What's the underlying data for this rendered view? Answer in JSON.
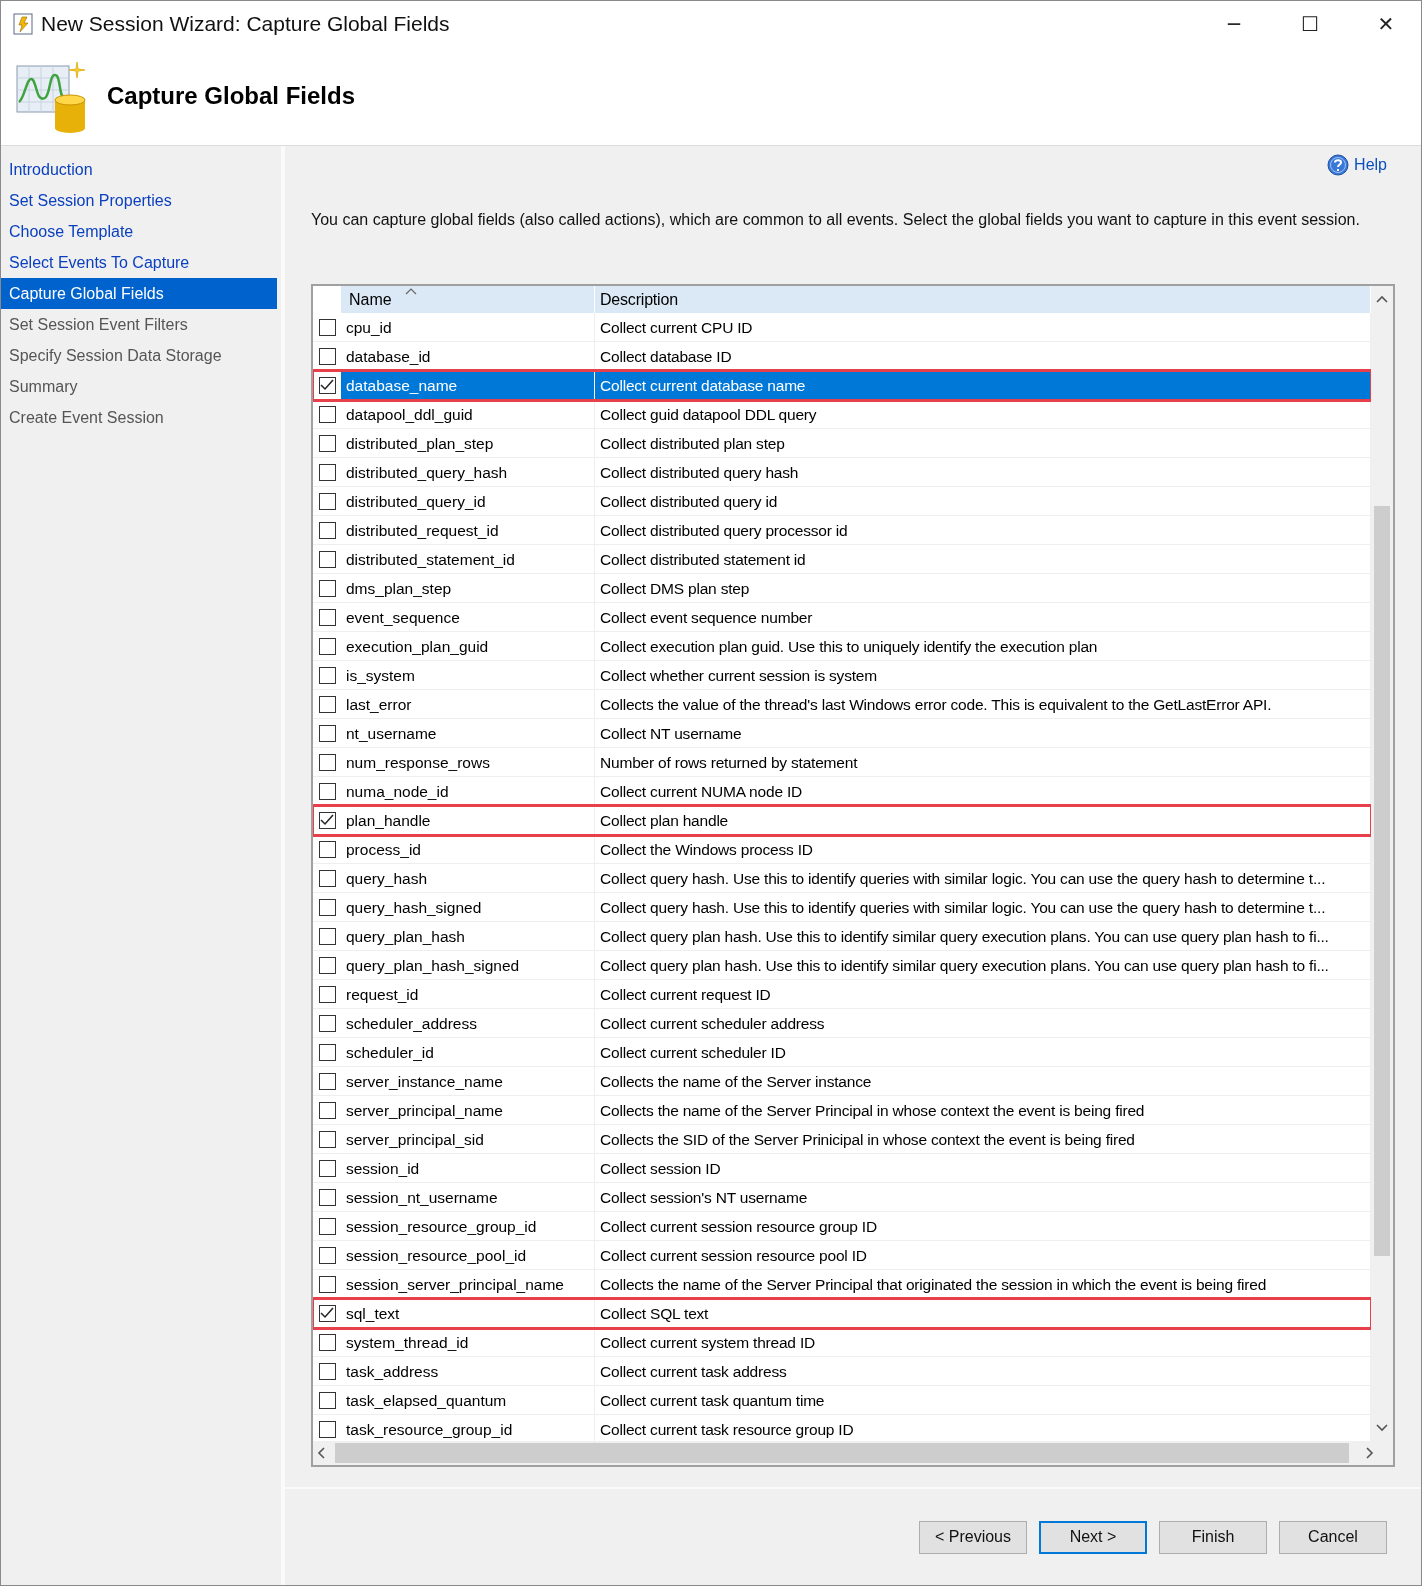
{
  "window": {
    "title": "New Session Wizard: Capture Global Fields",
    "controls": [
      "─",
      "☐",
      "✕"
    ]
  },
  "header": {
    "title": "Capture Global Fields"
  },
  "sidebar": {
    "items": [
      {
        "label": "Introduction",
        "selected": false,
        "disabled": false
      },
      {
        "label": "Set Session Properties",
        "selected": false,
        "disabled": false
      },
      {
        "label": "Choose Template",
        "selected": false,
        "disabled": false
      },
      {
        "label": "Select Events To Capture",
        "selected": false,
        "disabled": false
      },
      {
        "label": "Capture Global Fields",
        "selected": true,
        "disabled": false
      },
      {
        "label": "Set Session Event Filters",
        "selected": false,
        "disabled": true
      },
      {
        "label": "Specify Session Data Storage",
        "selected": false,
        "disabled": true
      },
      {
        "label": "Summary",
        "selected": false,
        "disabled": true
      },
      {
        "label": "Create Event Session",
        "selected": false,
        "disabled": true
      }
    ]
  },
  "help": {
    "label": "Help"
  },
  "intro": "You can capture global fields (also called actions), which are common to all events. Select the global fields you want to capture in this event session.",
  "table": {
    "columns": [
      {
        "label": "Name",
        "sorted": true
      },
      {
        "label": "Description"
      }
    ],
    "rows": [
      {
        "name": "cpu_id",
        "description": "Collect current CPU ID",
        "checked": false,
        "selected": false,
        "highlighted": false
      },
      {
        "name": "database_id",
        "description": "Collect database ID",
        "checked": false,
        "selected": false,
        "highlighted": false
      },
      {
        "name": "database_name",
        "description": "Collect current database name",
        "checked": true,
        "selected": true,
        "highlighted": true
      },
      {
        "name": "datapool_ddl_guid",
        "description": "Collect guid datapool DDL query",
        "checked": false,
        "selected": false,
        "highlighted": false
      },
      {
        "name": "distributed_plan_step",
        "description": "Collect distributed plan step",
        "checked": false,
        "selected": false,
        "highlighted": false
      },
      {
        "name": "distributed_query_hash",
        "description": "Collect distributed query hash",
        "checked": false,
        "selected": false,
        "highlighted": false
      },
      {
        "name": "distributed_query_id",
        "description": "Collect distributed query id",
        "checked": false,
        "selected": false,
        "highlighted": false
      },
      {
        "name": "distributed_request_id",
        "description": "Collect distributed query processor id",
        "checked": false,
        "selected": false,
        "highlighted": false
      },
      {
        "name": "distributed_statement_id",
        "description": "Collect distributed statement id",
        "checked": false,
        "selected": false,
        "highlighted": false
      },
      {
        "name": "dms_plan_step",
        "description": "Collect DMS plan step",
        "checked": false,
        "selected": false,
        "highlighted": false
      },
      {
        "name": "event_sequence",
        "description": "Collect event sequence number",
        "checked": false,
        "selected": false,
        "highlighted": false
      },
      {
        "name": "execution_plan_guid",
        "description": "Collect execution plan guid. Use this to uniquely identify the execution plan",
        "checked": false,
        "selected": false,
        "highlighted": false
      },
      {
        "name": "is_system",
        "description": "Collect whether current session is system",
        "checked": false,
        "selected": false,
        "highlighted": false
      },
      {
        "name": "last_error",
        "description": "Collects the value of the thread's last Windows error code. This is equivalent to the GetLastError API.",
        "checked": false,
        "selected": false,
        "highlighted": false
      },
      {
        "name": "nt_username",
        "description": "Collect NT username",
        "checked": false,
        "selected": false,
        "highlighted": false
      },
      {
        "name": "num_response_rows",
        "description": "Number of rows returned by statement",
        "checked": false,
        "selected": false,
        "highlighted": false
      },
      {
        "name": "numa_node_id",
        "description": "Collect current NUMA node ID",
        "checked": false,
        "selected": false,
        "highlighted": false
      },
      {
        "name": "plan_handle",
        "description": "Collect plan handle",
        "checked": true,
        "selected": false,
        "highlighted": true
      },
      {
        "name": "process_id",
        "description": "Collect the Windows process ID",
        "checked": false,
        "selected": false,
        "highlighted": false
      },
      {
        "name": "query_hash",
        "description": "Collect query hash. Use this to identify queries with similar logic. You can use the query hash to determine t...",
        "checked": false,
        "selected": false,
        "highlighted": false
      },
      {
        "name": "query_hash_signed",
        "description": "Collect query hash. Use this to identify queries with similar logic. You can use the query hash to determine t...",
        "checked": false,
        "selected": false,
        "highlighted": false
      },
      {
        "name": "query_plan_hash",
        "description": "Collect query plan hash. Use this to identify similar query execution plans. You can use query plan hash to fi...",
        "checked": false,
        "selected": false,
        "highlighted": false
      },
      {
        "name": "query_plan_hash_signed",
        "description": "Collect query plan hash. Use this to identify similar query execution plans. You can use query plan hash to fi...",
        "checked": false,
        "selected": false,
        "highlighted": false
      },
      {
        "name": "request_id",
        "description": "Collect current request ID",
        "checked": false,
        "selected": false,
        "highlighted": false
      },
      {
        "name": "scheduler_address",
        "description": "Collect current scheduler address",
        "checked": false,
        "selected": false,
        "highlighted": false
      },
      {
        "name": "scheduler_id",
        "description": "Collect current scheduler ID",
        "checked": false,
        "selected": false,
        "highlighted": false
      },
      {
        "name": "server_instance_name",
        "description": "Collects the name of the Server instance",
        "checked": false,
        "selected": false,
        "highlighted": false
      },
      {
        "name": "server_principal_name",
        "description": "Collects the name of the Server Principal in whose context the event is being fired",
        "checked": false,
        "selected": false,
        "highlighted": false
      },
      {
        "name": "server_principal_sid",
        "description": "Collects the SID of the Server Prinicipal in whose context the event is being fired",
        "checked": false,
        "selected": false,
        "highlighted": false
      },
      {
        "name": "session_id",
        "description": "Collect session ID",
        "checked": false,
        "selected": false,
        "highlighted": false
      },
      {
        "name": "session_nt_username",
        "description": "Collect session's NT username",
        "checked": false,
        "selected": false,
        "highlighted": false
      },
      {
        "name": "session_resource_group_id",
        "description": "Collect current session resource group ID",
        "checked": false,
        "selected": false,
        "highlighted": false
      },
      {
        "name": "session_resource_pool_id",
        "description": "Collect current session resource pool ID",
        "checked": false,
        "selected": false,
        "highlighted": false
      },
      {
        "name": "session_server_principal_name",
        "description": "Collects the name of the Server Principal that originated the session in which the event is being fired",
        "checked": false,
        "selected": false,
        "highlighted": false
      },
      {
        "name": "sql_text",
        "description": "Collect SQL text",
        "checked": true,
        "selected": false,
        "highlighted": true
      },
      {
        "name": "system_thread_id",
        "description": "Collect current system thread ID",
        "checked": false,
        "selected": false,
        "highlighted": false
      },
      {
        "name": "task_address",
        "description": "Collect current task address",
        "checked": false,
        "selected": false,
        "highlighted": false
      },
      {
        "name": "task_elapsed_quantum",
        "description": "Collect current task quantum time",
        "checked": false,
        "selected": false,
        "highlighted": false
      },
      {
        "name": "task_resource_group_id",
        "description": "Collect current task resource group ID",
        "checked": false,
        "selected": false,
        "highlighted": false
      }
    ]
  },
  "buttons": [
    {
      "label": "< Previous",
      "default": false
    },
    {
      "label": "Next >",
      "default": true
    },
    {
      "label": "Finish",
      "default": false
    },
    {
      "label": "Cancel",
      "default": false
    }
  ]
}
